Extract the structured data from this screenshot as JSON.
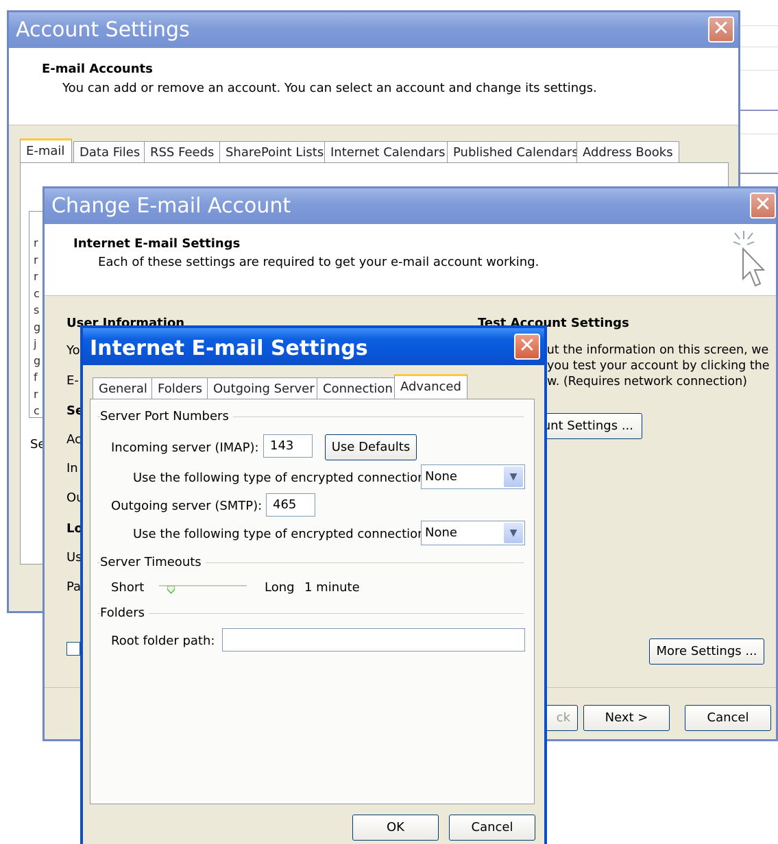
{
  "account_settings": {
    "title": "Account Settings",
    "header_title": "E-mail Accounts",
    "header_desc": "You can add or remove an account. You can select an account and change its settings.",
    "tabs": [
      "E-mail",
      "Data Files",
      "RSS Feeds",
      "SharePoint Lists",
      "Internet Calendars",
      "Published Calendars",
      "Address Books"
    ],
    "selected_tab": "E-mail",
    "partial_list_letters": [
      "r",
      "r",
      "r",
      "c",
      "s",
      "g",
      "j",
      "g",
      "f",
      "r",
      "c"
    ],
    "partial_se": "Se"
  },
  "change_account": {
    "title": "Change E-mail Account",
    "header_title": "Internet E-mail Settings",
    "header_desc": "Each of these settings are required to get your e-mail account working.",
    "user_info_heading": "User Information",
    "test_heading": "Test Account Settings",
    "test_desc_1": "out the information on this screen, we",
    "test_desc_2": "you test your account by clicking the",
    "test_desc_3": "w. (Requires network connection)",
    "test_button_partial": "unt Settings ...",
    "more_settings": "More Settings ...",
    "back_partial": "ck",
    "next": "Next >",
    "cancel": "Cancel",
    "left_fragments": [
      "Yo",
      "E-",
      "Se",
      "Ac",
      "In",
      "Ou",
      "Lo",
      "Us",
      "Pa"
    ]
  },
  "internet_settings": {
    "title": "Internet E-mail Settings",
    "tabs": [
      "General",
      "Folders",
      "Outgoing Server",
      "Connection",
      "Advanced"
    ],
    "selected_tab": "Advanced",
    "server_ports_label": "Server Port Numbers",
    "incoming_label": "Incoming server (IMAP):",
    "incoming_value": "143",
    "use_defaults": "Use Defaults",
    "encrypt_label": "Use the following type of encrypted connection:",
    "incoming_encrypt": "None",
    "outgoing_label": "Outgoing server (SMTP):",
    "outgoing_value": "465",
    "outgoing_encrypt": "None",
    "timeouts_label": "Server Timeouts",
    "short_label": "Short",
    "long_label": "Long",
    "timeout_value": "1 minute",
    "timeout_level": 0.1,
    "folders_label": "Folders",
    "root_folder_label": "Root folder path:",
    "root_folder_value": "",
    "ok": "OK",
    "cancel": "Cancel"
  }
}
